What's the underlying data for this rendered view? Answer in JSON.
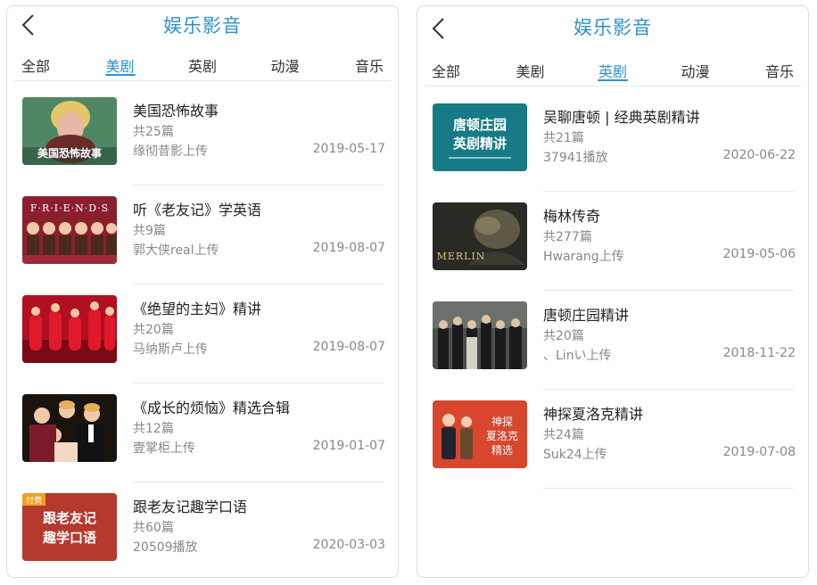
{
  "left": {
    "title": "娱乐影音",
    "tabs": [
      {
        "label": "全部",
        "active": false
      },
      {
        "label": "美剧",
        "active": true
      },
      {
        "label": "英剧",
        "active": false
      },
      {
        "label": "动漫",
        "active": false
      },
      {
        "label": "音乐",
        "active": false
      }
    ],
    "items": [
      {
        "title": "美国恐怖故事",
        "count": "共25篇",
        "meta": "缘彻昔影上传",
        "date": "2019-05-17",
        "thumb_text": "美国恐怖故事"
      },
      {
        "title": "听《老友记》学英语",
        "count": "共9篇",
        "meta": "郭大侠real上传",
        "date": "2019-08-07",
        "thumb_text": "F·R·I·E·N·D·S"
      },
      {
        "title": "《绝望的主妇》精讲",
        "count": "共20篇",
        "meta": "马纳斯卢上传",
        "date": "2019-08-07"
      },
      {
        "title": "《成长的烦恼》精选合辑",
        "count": "共12篇",
        "meta": "壹掌柜上传",
        "date": "2019-01-07"
      },
      {
        "title": "跟老友记趣学口语",
        "count": "共60篇",
        "meta": "20509播放",
        "date": "2020-03-03",
        "thumb_text_1": "跟老友记",
        "thumb_text_2": "趣学口语",
        "badge": "付费"
      }
    ]
  },
  "right": {
    "title": "娱乐影音",
    "tabs": [
      {
        "label": "全部",
        "active": false
      },
      {
        "label": "美剧",
        "active": false
      },
      {
        "label": "英剧",
        "active": true
      },
      {
        "label": "动漫",
        "active": false
      },
      {
        "label": "音乐",
        "active": false
      }
    ],
    "items": [
      {
        "title": "吴聊唐顿 | 经典英剧精讲",
        "count": "共21篇",
        "meta": "37941播放",
        "date": "2020-06-22",
        "thumb_text_1": "唐顿庄园",
        "thumb_text_2": "英剧精讲"
      },
      {
        "title": "梅林传奇",
        "count": "共277篇",
        "meta": "Hwarang上传",
        "date": "2019-05-06",
        "thumb_text": "MERLIN"
      },
      {
        "title": "唐顿庄园精讲",
        "count": "共20篇",
        "meta": "、Linい上传",
        "date": "2018-11-22"
      },
      {
        "title": "神探夏洛克精讲",
        "count": "共24篇",
        "meta": "Suk24上传",
        "date": "2019-07-08",
        "thumb_text_1": "神探",
        "thumb_text_2": "夏洛克",
        "thumb_text_3": "精选"
      }
    ]
  },
  "colors": {
    "accent": "#2f8fd0",
    "text": "#222222",
    "muted": "#888888",
    "divider": "#e8e8e8"
  }
}
